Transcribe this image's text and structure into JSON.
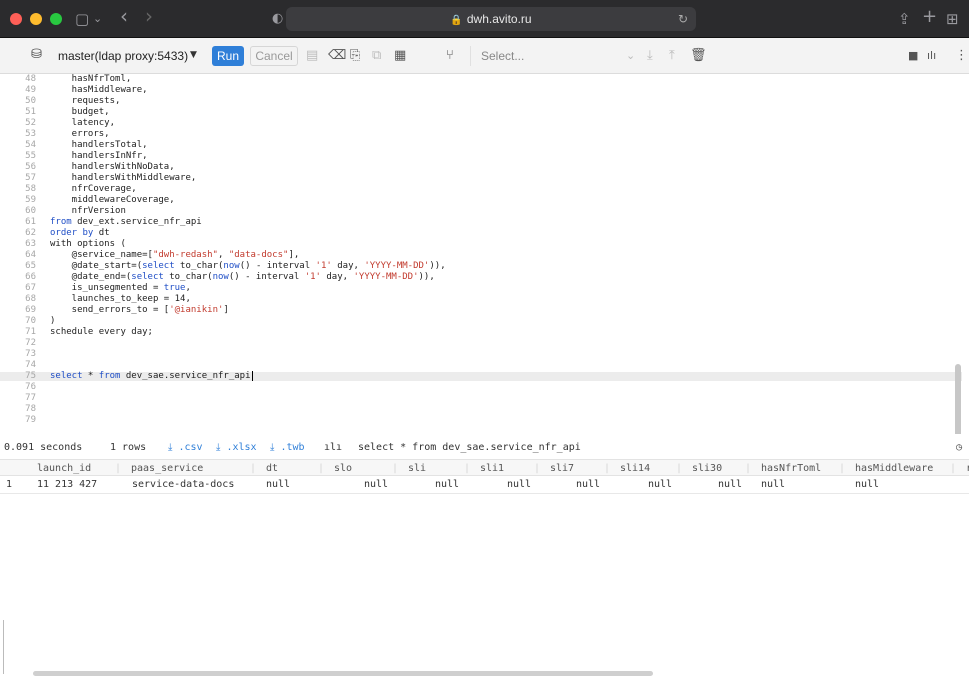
{
  "browser": {
    "url": "dwh.avito.ru",
    "colors": {
      "close": "#fe5f57",
      "minimize": "#febc2e",
      "zoom": "#28c840"
    },
    "icons": {
      "sidebar": "▢",
      "sidebar_caret": "⌄",
      "back": "‹",
      "forward": "›",
      "shield": "◐",
      "lock": "🔒",
      "reload": "↻",
      "share": "⇪",
      "new_tab": "+",
      "tabs": "⊞"
    }
  },
  "toolbar": {
    "connection": "master(ldap proxy:5433)",
    "connection_caret": "▼",
    "run_label": "Run",
    "cancel_label": "Cancel",
    "select_placeholder": "Select...",
    "select_caret": "⌄",
    "icons": {
      "database": "⛁",
      "format": "▤",
      "eraser": "⌫",
      "bookmark": "⎘",
      "copy": "⧉",
      "save": "▦",
      "fork": "⑂",
      "download": "⤓",
      "upload": "⤒",
      "trash": "🗑",
      "panel": "■",
      "chart": "ılı",
      "more": "⋮"
    }
  },
  "editor": {
    "lines": [
      {
        "n": "48",
        "html": "    hasNfrToml,"
      },
      {
        "n": "49",
        "html": "    hasMiddleware,"
      },
      {
        "n": "50",
        "html": "    requests,"
      },
      {
        "n": "51",
        "html": "    budget,"
      },
      {
        "n": "52",
        "html": "    latency,"
      },
      {
        "n": "53",
        "html": "    errors,"
      },
      {
        "n": "54",
        "html": "    handlersTotal,"
      },
      {
        "n": "55",
        "html": "    handlersInNfr,"
      },
      {
        "n": "56",
        "html": "    handlersWithNoData,"
      },
      {
        "n": "57",
        "html": "    handlersWithMiddleware,"
      },
      {
        "n": "58",
        "html": "    nfrCoverage,"
      },
      {
        "n": "59",
        "html": "    middlewareCoverage,"
      },
      {
        "n": "60",
        "html": "    nfrVersion"
      },
      {
        "n": "61",
        "html": "<span class=\"kw\">from</span> dev_ext.service_nfr_api"
      },
      {
        "n": "62",
        "html": "<span class=\"kw\">order by</span> dt"
      },
      {
        "n": "63",
        "html": "with options ("
      },
      {
        "n": "64",
        "html": "    @service_name=[<span class=\"str\">\"dwh-redash\"</span>, <span class=\"str\">\"data-docs\"</span>],"
      },
      {
        "n": "65",
        "html": "    @date_start=(<span class=\"kw\">select</span> to_char(<span class=\"kw\">now</span>() - interval <span class=\"str\">'1'</span> day, <span class=\"str\">'YYYY-MM-DD'</span>)),"
      },
      {
        "n": "66",
        "html": "    @date_end=(<span class=\"kw\">select</span> to_char(<span class=\"kw\">now</span>() - interval <span class=\"str\">'1'</span> day, <span class=\"str\">'YYYY-MM-DD'</span>)),"
      },
      {
        "n": "67",
        "html": "    is_unsegmented = <span class=\"kw\">true</span>,"
      },
      {
        "n": "68",
        "html": "    launches_to_keep = 14,"
      },
      {
        "n": "69",
        "html": "    send_errors_to = [<span class=\"str\">'@ianikin'</span>]"
      },
      {
        "n": "70",
        "html": ")"
      },
      {
        "n": "71",
        "html": "schedule every day;"
      },
      {
        "n": "72",
        "html": ""
      },
      {
        "n": "73",
        "html": ""
      },
      {
        "n": "74",
        "html": ""
      },
      {
        "n": "75",
        "html": "<span class=\"kw\">select</span> * <span class=\"kw\">from</span> dev_sae.service_nfr_api",
        "active": true
      },
      {
        "n": "76",
        "html": ""
      },
      {
        "n": "77",
        "html": ""
      },
      {
        "n": "78",
        "html": ""
      },
      {
        "n": "79",
        "html": ""
      }
    ]
  },
  "status": {
    "time": "0.091 seconds",
    "rows": "1 rows",
    "csv": "⤓ .csv",
    "xlsx": "⤓ .xlsx",
    "twb": "⤓ .twb",
    "chart_icon": "ılı",
    "query": "select * from dev_sae.service_nfr_api",
    "history_icon": "◷"
  },
  "results": {
    "columns": [
      "launch_id",
      "paas_service",
      "dt",
      "slo",
      "sli",
      "sli1",
      "sli7",
      "sli14",
      "sli30",
      "hasNfrToml",
      "hasMiddleware",
      "re"
    ],
    "rows": [
      {
        "index": "1",
        "cells": [
          "11 213 427",
          "service-data-docs",
          "null",
          "null",
          "null",
          "null",
          "null",
          "null",
          "null",
          "null",
          "null"
        ]
      }
    ]
  }
}
